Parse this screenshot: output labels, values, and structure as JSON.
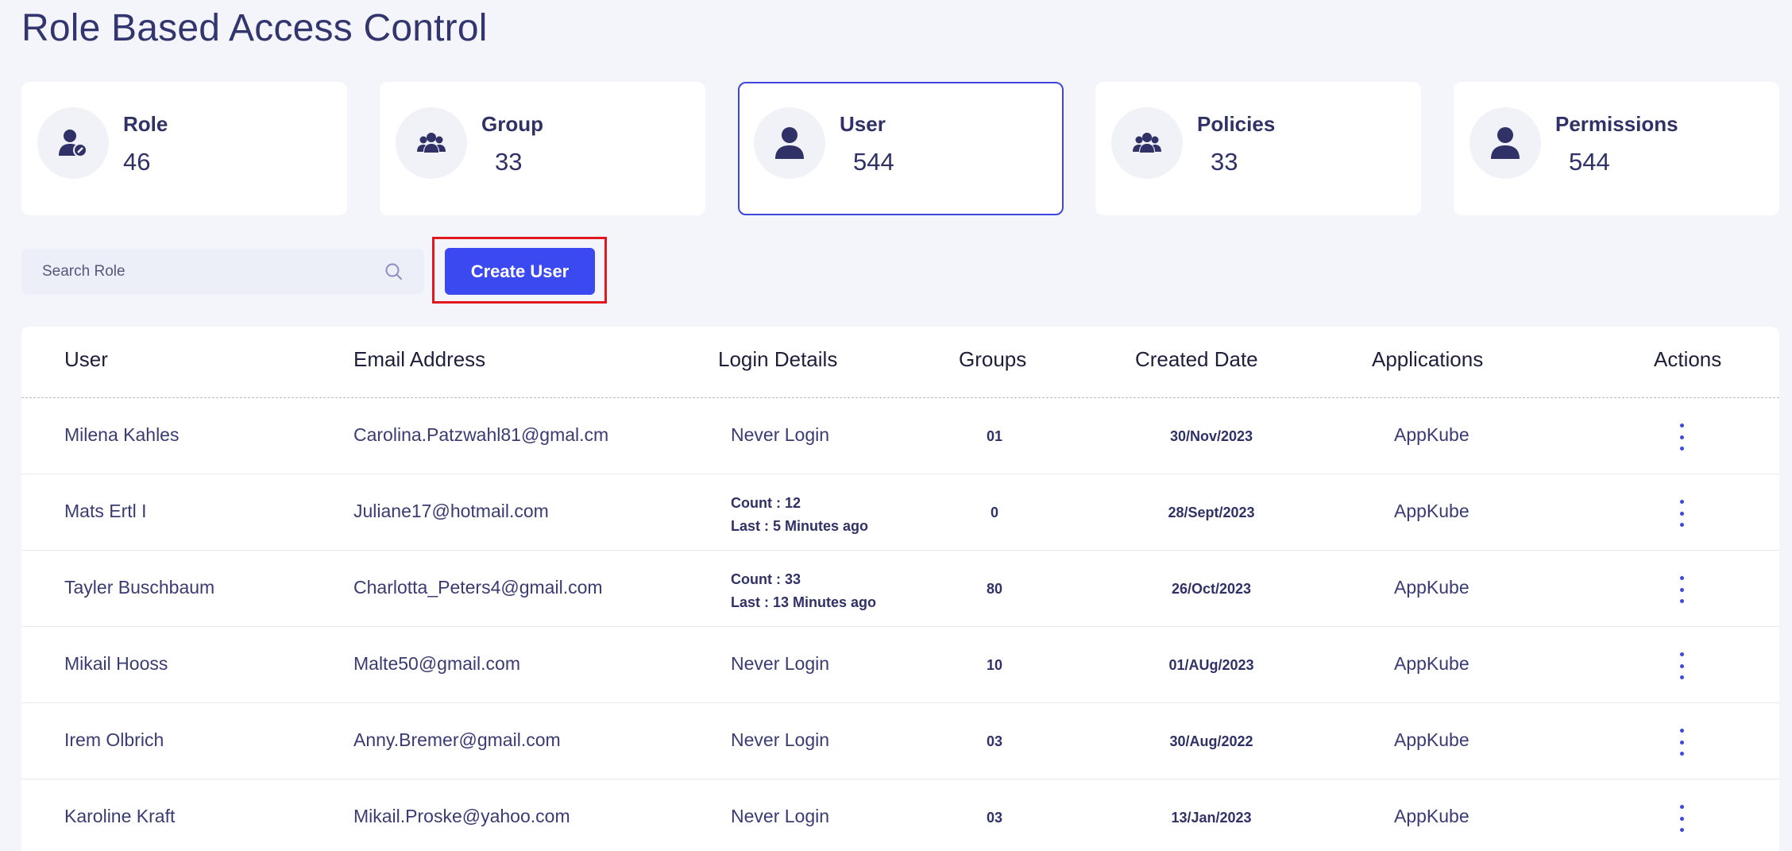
{
  "page": {
    "title": "Role Based Access Control"
  },
  "cards": [
    {
      "label": "Role",
      "count": "46",
      "icon": "user-gear-icon"
    },
    {
      "label": "Group",
      "count": "33",
      "icon": "users-group-icon"
    },
    {
      "label": "User",
      "count": "544",
      "icon": "user-icon",
      "active": true
    },
    {
      "label": "Policies",
      "count": "33",
      "icon": "users-group-icon"
    },
    {
      "label": "Permissions",
      "count": "544",
      "icon": "user-icon"
    }
  ],
  "search": {
    "placeholder": "Search Role",
    "icon": "search-icon"
  },
  "toolbar": {
    "create_label": "Create User"
  },
  "table": {
    "headers": [
      "User",
      "Email Address",
      "Login Details",
      "Groups",
      "Created Date",
      "Applications",
      "Actions"
    ],
    "rows": [
      {
        "user": "Milena Kahles",
        "email": "Carolina.Patzwahl81@gmal.cm",
        "login": "Never Login",
        "count": "",
        "last": "",
        "groups": "01",
        "created": "30/Nov/2023",
        "app": "AppKube"
      },
      {
        "user": "Mats Ertl I",
        "email": "Juliane17@hotmail.com",
        "login": "",
        "count": "Count : 12",
        "last": "Last  : 5 Minutes ago",
        "groups": "0",
        "created": "28/Sept/2023",
        "app": "AppKube"
      },
      {
        "user": "Tayler Buschbaum",
        "email": "Charlotta_Peters4@gmail.com",
        "login": "",
        "count": "Count : 33",
        "last": "Last  : 13 Minutes ago",
        "groups": "80",
        "created": "26/Oct/2023",
        "app": "AppKube"
      },
      {
        "user": "Mikail Hooss",
        "email": "Malte50@gmail.com",
        "login": "Never Login",
        "count": "",
        "last": "",
        "groups": "10",
        "created": "01/AUg/2023",
        "app": "AppKube"
      },
      {
        "user": "Irem Olbrich",
        "email": "Anny.Bremer@gmail.com",
        "login": "Never Login",
        "count": "",
        "last": "",
        "groups": "03",
        "created": "30/Aug/2022",
        "app": "AppKube"
      },
      {
        "user": "Karoline Kraft",
        "email": "Mikail.Proske@yahoo.com",
        "login": "Never Login",
        "count": "",
        "last": "",
        "groups": "03",
        "created": "13/Jan/2023",
        "app": "AppKube"
      }
    ]
  },
  "colors": {
    "accent": "#3b49f0",
    "highlight": "#e0191f",
    "text": "#2f3167",
    "background": "#f4f5fa"
  }
}
